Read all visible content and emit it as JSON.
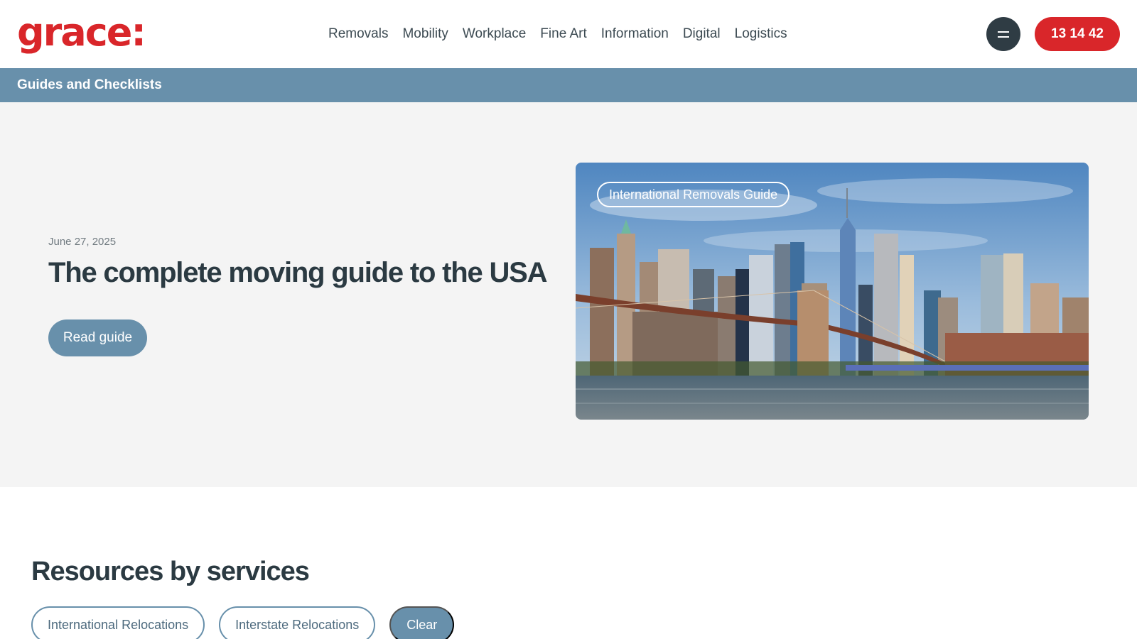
{
  "header": {
    "logo_text": "grace:",
    "nav": [
      {
        "label": "Removals"
      },
      {
        "label": "Mobility"
      },
      {
        "label": "Workplace"
      },
      {
        "label": "Fine Art"
      },
      {
        "label": "Information"
      },
      {
        "label": "Digital"
      },
      {
        "label": "Logistics"
      }
    ],
    "menu_icon": "hamburger-menu-icon",
    "phone_label": "13 14 42"
  },
  "breadcrumb": {
    "label": "Guides and Checklists"
  },
  "hero": {
    "date": "June 27, 2025",
    "title": "The complete moving guide to the USA",
    "cta_label": "Read guide",
    "image_tag": "International Removals Guide"
  },
  "resources": {
    "title": "Resources by services",
    "filters": [
      {
        "label": "International Relocations"
      },
      {
        "label": "Interstate Relocations"
      }
    ],
    "clear_label": "Clear"
  },
  "colors": {
    "brand_red": "#d9262a",
    "accent_blue": "#6890ab",
    "dark": "#2f3c44"
  }
}
